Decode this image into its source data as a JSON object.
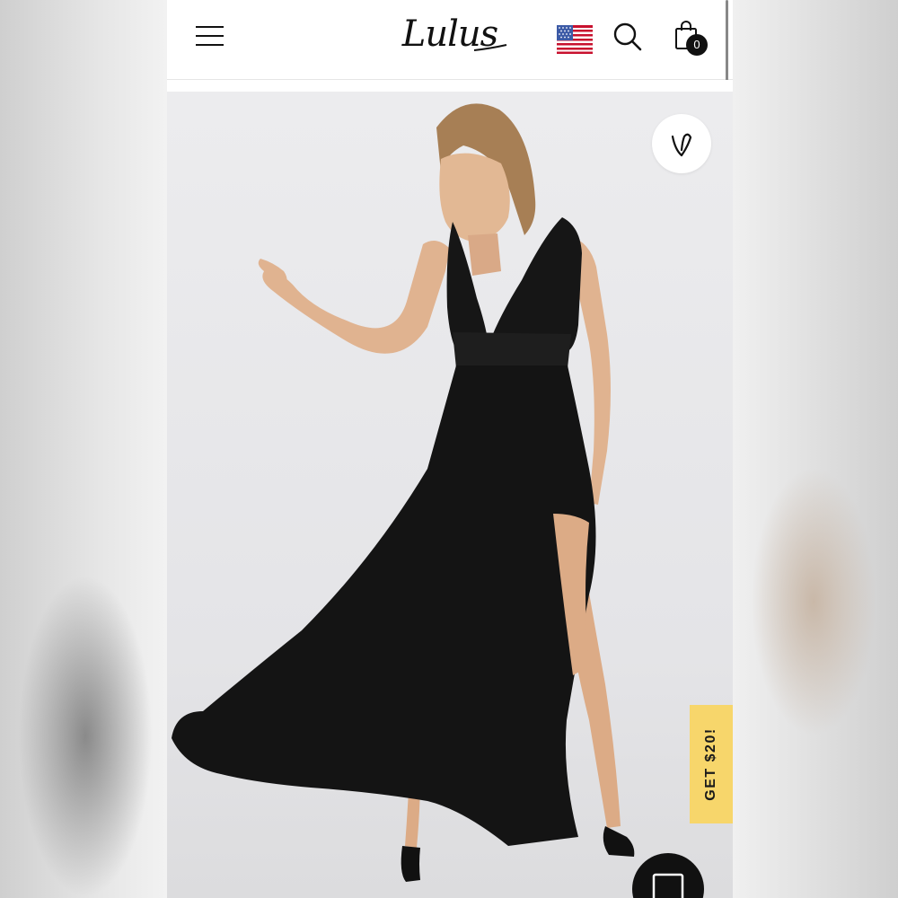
{
  "header": {
    "brand": "Lulus",
    "cart_count": "0"
  },
  "icons": {
    "menu": "menu-icon",
    "flag": "us-flag-icon",
    "search": "search-icon",
    "cart": "shopping-bag-icon",
    "favorite": "heart-icon",
    "chat": "chat-icon"
  },
  "promo": {
    "label": "GET $20!"
  },
  "product_image": {
    "subject": "model in black maxi dress with side slit"
  },
  "colors": {
    "promo_bg": "#f7d66b",
    "dress": "#141414",
    "background": "#e8e8ea"
  }
}
